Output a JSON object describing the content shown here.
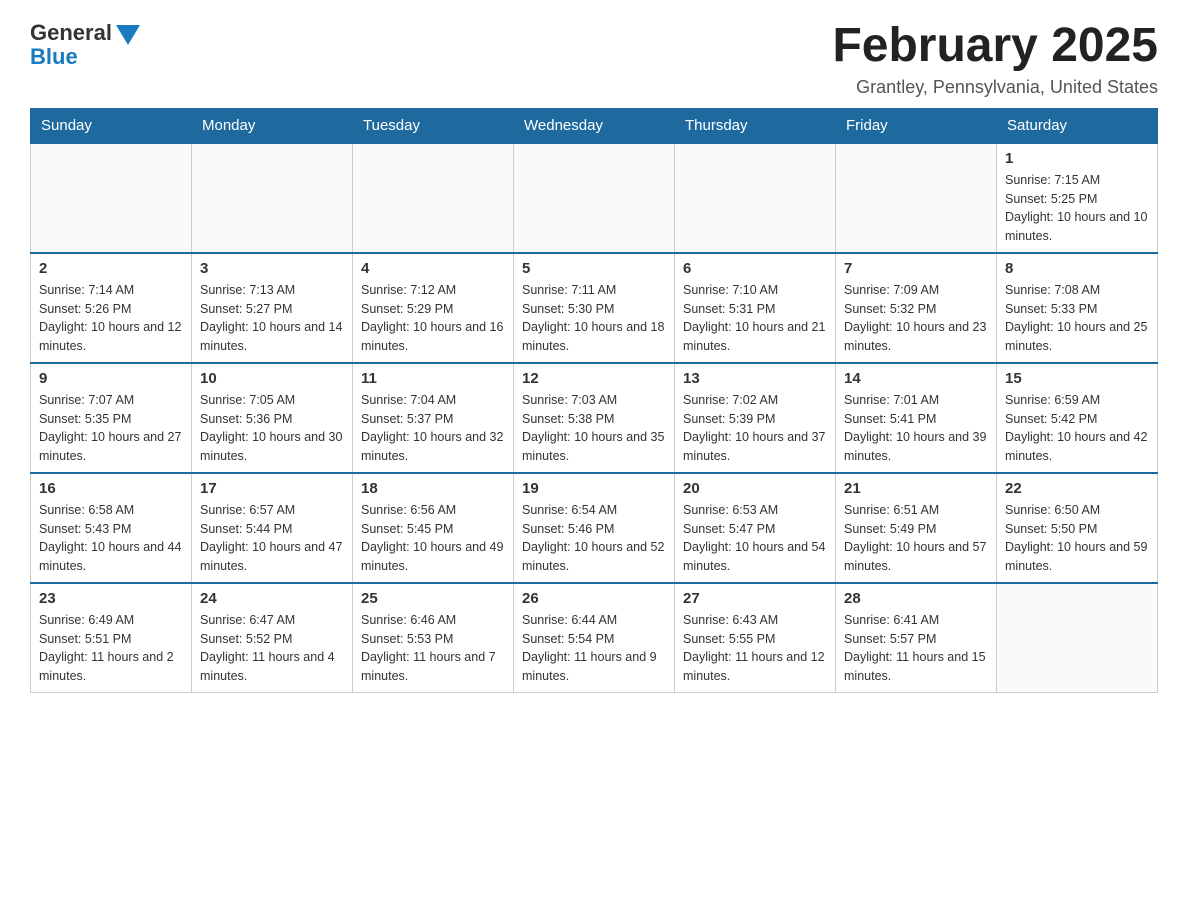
{
  "logo": {
    "general": "General",
    "blue": "Blue"
  },
  "title": "February 2025",
  "location": "Grantley, Pennsylvania, United States",
  "weekdays": [
    "Sunday",
    "Monday",
    "Tuesday",
    "Wednesday",
    "Thursday",
    "Friday",
    "Saturday"
  ],
  "weeks": [
    [
      {
        "day": "",
        "info": ""
      },
      {
        "day": "",
        "info": ""
      },
      {
        "day": "",
        "info": ""
      },
      {
        "day": "",
        "info": ""
      },
      {
        "day": "",
        "info": ""
      },
      {
        "day": "",
        "info": ""
      },
      {
        "day": "1",
        "info": "Sunrise: 7:15 AM\nSunset: 5:25 PM\nDaylight: 10 hours and 10 minutes."
      }
    ],
    [
      {
        "day": "2",
        "info": "Sunrise: 7:14 AM\nSunset: 5:26 PM\nDaylight: 10 hours and 12 minutes."
      },
      {
        "day": "3",
        "info": "Sunrise: 7:13 AM\nSunset: 5:27 PM\nDaylight: 10 hours and 14 minutes."
      },
      {
        "day": "4",
        "info": "Sunrise: 7:12 AM\nSunset: 5:29 PM\nDaylight: 10 hours and 16 minutes."
      },
      {
        "day": "5",
        "info": "Sunrise: 7:11 AM\nSunset: 5:30 PM\nDaylight: 10 hours and 18 minutes."
      },
      {
        "day": "6",
        "info": "Sunrise: 7:10 AM\nSunset: 5:31 PM\nDaylight: 10 hours and 21 minutes."
      },
      {
        "day": "7",
        "info": "Sunrise: 7:09 AM\nSunset: 5:32 PM\nDaylight: 10 hours and 23 minutes."
      },
      {
        "day": "8",
        "info": "Sunrise: 7:08 AM\nSunset: 5:33 PM\nDaylight: 10 hours and 25 minutes."
      }
    ],
    [
      {
        "day": "9",
        "info": "Sunrise: 7:07 AM\nSunset: 5:35 PM\nDaylight: 10 hours and 27 minutes."
      },
      {
        "day": "10",
        "info": "Sunrise: 7:05 AM\nSunset: 5:36 PM\nDaylight: 10 hours and 30 minutes."
      },
      {
        "day": "11",
        "info": "Sunrise: 7:04 AM\nSunset: 5:37 PM\nDaylight: 10 hours and 32 minutes."
      },
      {
        "day": "12",
        "info": "Sunrise: 7:03 AM\nSunset: 5:38 PM\nDaylight: 10 hours and 35 minutes."
      },
      {
        "day": "13",
        "info": "Sunrise: 7:02 AM\nSunset: 5:39 PM\nDaylight: 10 hours and 37 minutes."
      },
      {
        "day": "14",
        "info": "Sunrise: 7:01 AM\nSunset: 5:41 PM\nDaylight: 10 hours and 39 minutes."
      },
      {
        "day": "15",
        "info": "Sunrise: 6:59 AM\nSunset: 5:42 PM\nDaylight: 10 hours and 42 minutes."
      }
    ],
    [
      {
        "day": "16",
        "info": "Sunrise: 6:58 AM\nSunset: 5:43 PM\nDaylight: 10 hours and 44 minutes."
      },
      {
        "day": "17",
        "info": "Sunrise: 6:57 AM\nSunset: 5:44 PM\nDaylight: 10 hours and 47 minutes."
      },
      {
        "day": "18",
        "info": "Sunrise: 6:56 AM\nSunset: 5:45 PM\nDaylight: 10 hours and 49 minutes."
      },
      {
        "day": "19",
        "info": "Sunrise: 6:54 AM\nSunset: 5:46 PM\nDaylight: 10 hours and 52 minutes."
      },
      {
        "day": "20",
        "info": "Sunrise: 6:53 AM\nSunset: 5:47 PM\nDaylight: 10 hours and 54 minutes."
      },
      {
        "day": "21",
        "info": "Sunrise: 6:51 AM\nSunset: 5:49 PM\nDaylight: 10 hours and 57 minutes."
      },
      {
        "day": "22",
        "info": "Sunrise: 6:50 AM\nSunset: 5:50 PM\nDaylight: 10 hours and 59 minutes."
      }
    ],
    [
      {
        "day": "23",
        "info": "Sunrise: 6:49 AM\nSunset: 5:51 PM\nDaylight: 11 hours and 2 minutes."
      },
      {
        "day": "24",
        "info": "Sunrise: 6:47 AM\nSunset: 5:52 PM\nDaylight: 11 hours and 4 minutes."
      },
      {
        "day": "25",
        "info": "Sunrise: 6:46 AM\nSunset: 5:53 PM\nDaylight: 11 hours and 7 minutes."
      },
      {
        "day": "26",
        "info": "Sunrise: 6:44 AM\nSunset: 5:54 PM\nDaylight: 11 hours and 9 minutes."
      },
      {
        "day": "27",
        "info": "Sunrise: 6:43 AM\nSunset: 5:55 PM\nDaylight: 11 hours and 12 minutes."
      },
      {
        "day": "28",
        "info": "Sunrise: 6:41 AM\nSunset: 5:57 PM\nDaylight: 11 hours and 15 minutes."
      },
      {
        "day": "",
        "info": ""
      }
    ]
  ]
}
